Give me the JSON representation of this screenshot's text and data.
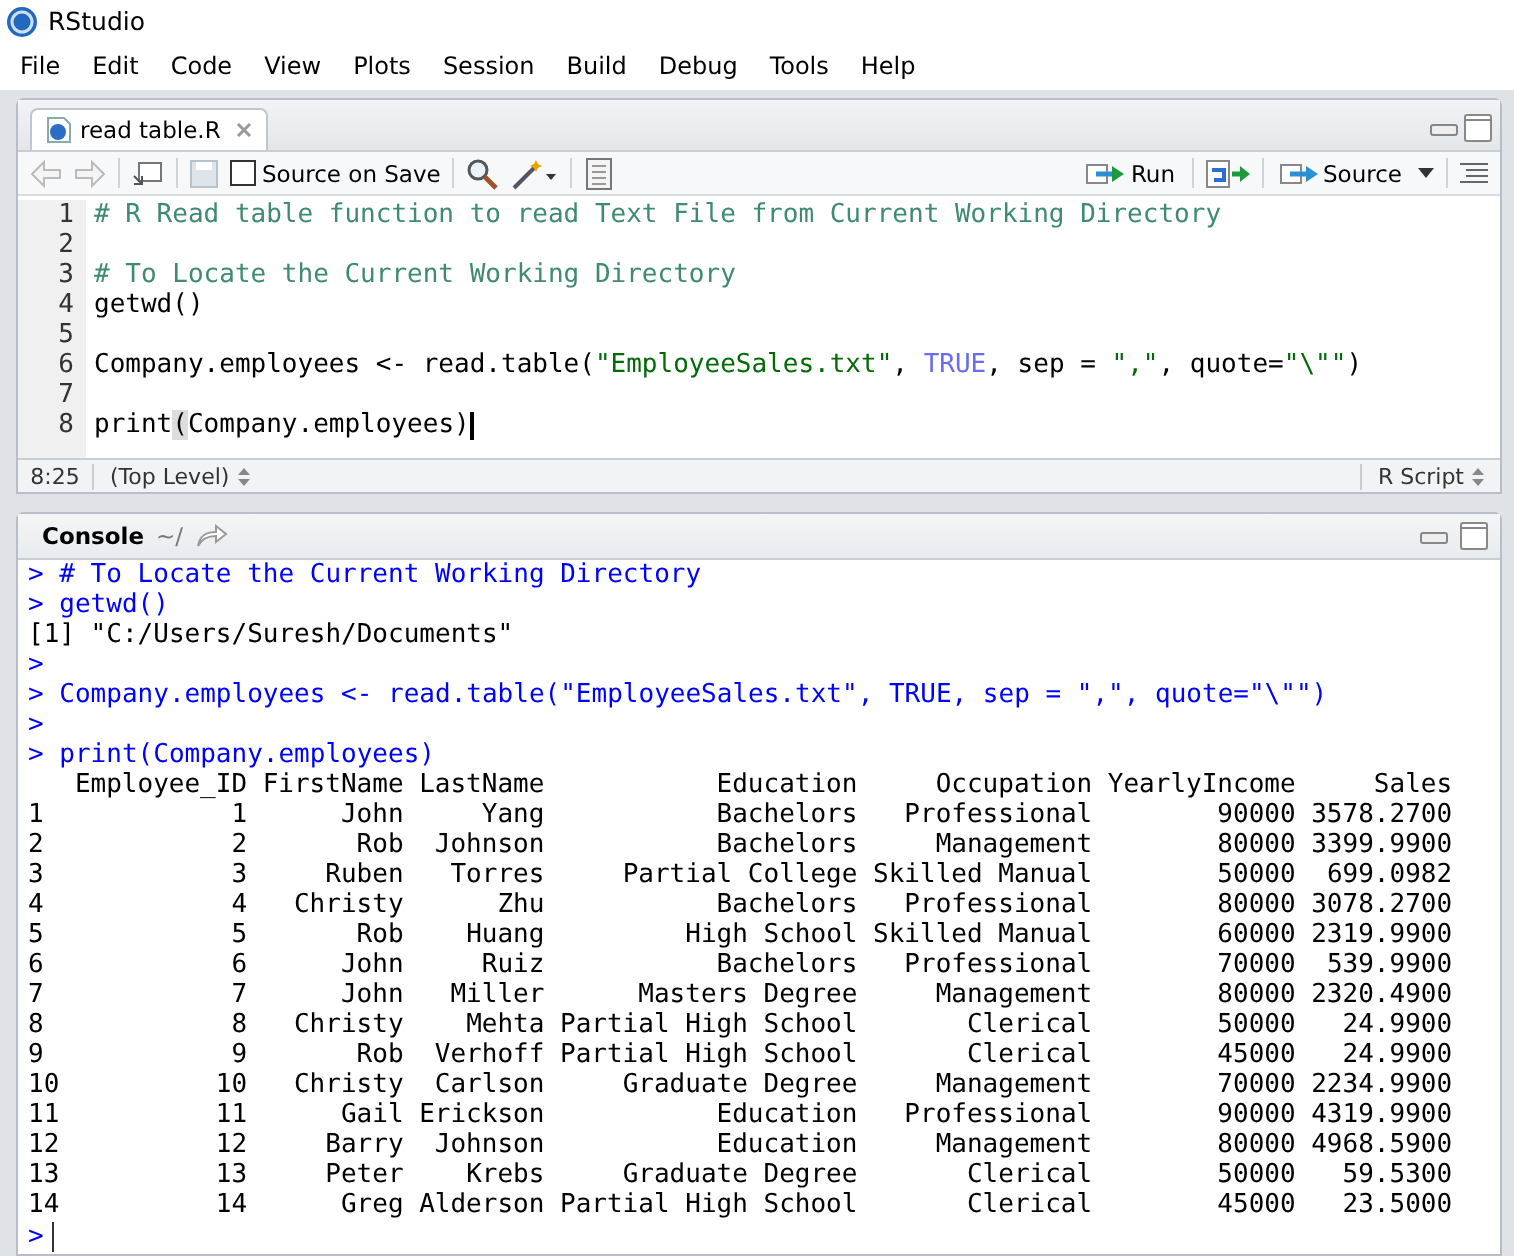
{
  "window": {
    "title": "RStudio"
  },
  "menu": [
    "File",
    "Edit",
    "Code",
    "View",
    "Plots",
    "Session",
    "Build",
    "Debug",
    "Tools",
    "Help"
  ],
  "editor": {
    "tab": {
      "label": "read table.R",
      "selected": true
    },
    "toolbar": {
      "source_on_save": {
        "label": "Source on Save",
        "checked": false
      },
      "run": "Run",
      "source": "Source"
    },
    "lines": [
      {
        "number": "1",
        "segments": [
          {
            "kind": "comment",
            "text": "# R Read table function to read Text File from Current Working Directory"
          }
        ]
      },
      {
        "number": "2"
      },
      {
        "number": "3",
        "segments": [
          {
            "kind": "comment",
            "text": "# To Locate the Current Working Directory"
          }
        ]
      },
      {
        "number": "4",
        "segments": [
          {
            "kind": "plain",
            "text": "getwd()"
          }
        ]
      },
      {
        "number": "5"
      },
      {
        "number": "6",
        "segments": [
          {
            "kind": "plain",
            "text": "Company.employees <- read.table("
          },
          {
            "kind": "string",
            "text": "\"EmployeeSales.txt\""
          },
          {
            "kind": "plain",
            "text": ", "
          },
          {
            "kind": "keyword",
            "text": "TRUE"
          },
          {
            "kind": "plain",
            "text": ", sep = "
          },
          {
            "kind": "string",
            "text": "\",\""
          },
          {
            "kind": "plain",
            "text": ", quote="
          },
          {
            "kind": "string",
            "text": "\"\\\"\""
          },
          {
            "kind": "plain",
            "text": ")"
          }
        ]
      },
      {
        "number": "7"
      },
      {
        "number": "8",
        "cursor": true,
        "segments": [
          {
            "kind": "plain",
            "text": "print"
          },
          {
            "kind": "match",
            "text": "("
          },
          {
            "kind": "plain",
            "text": "Company.employees)"
          }
        ]
      }
    ],
    "status": {
      "position": "8:25",
      "scope": "(Top Level)",
      "file_type": "R Script"
    }
  },
  "console": {
    "title": "Console",
    "path": "~/",
    "lines": [
      {
        "kind": "input",
        "text": "> # To Locate the Current Working Directory"
      },
      {
        "kind": "input",
        "text": "> getwd()"
      },
      {
        "kind": "output",
        "text": "[1] \"C:/Users/Suresh/Documents\""
      },
      {
        "kind": "input",
        "text": ">"
      },
      {
        "kind": "input",
        "text": "> Company.employees <- read.table(\"EmployeeSales.txt\", TRUE, sep = \",\", quote=\"\\\"\")"
      },
      {
        "kind": "input",
        "text": ">"
      },
      {
        "kind": "input",
        "text": "> print(Company.employees)"
      }
    ],
    "table": {
      "columns": [
        "",
        "Employee_ID",
        "FirstName",
        "LastName",
        "Education",
        "Occupation",
        "YearlyIncome",
        "Sales"
      ],
      "rows": [
        [
          "1",
          "1",
          "John",
          "Yang",
          "Bachelors",
          "Professional",
          "90000",
          "3578.2700"
        ],
        [
          "2",
          "2",
          "Rob",
          "Johnson",
          "Bachelors",
          "Management",
          "80000",
          "3399.9900"
        ],
        [
          "3",
          "3",
          "Ruben",
          "Torres",
          "Partial College",
          "Skilled Manual",
          "50000",
          "699.0982"
        ],
        [
          "4",
          "4",
          "Christy",
          "Zhu",
          "Bachelors",
          "Professional",
          "80000",
          "3078.2700"
        ],
        [
          "5",
          "5",
          "Rob",
          "Huang",
          "High School",
          "Skilled Manual",
          "60000",
          "2319.9900"
        ],
        [
          "6",
          "6",
          "John",
          "Ruiz",
          "Bachelors",
          "Professional",
          "70000",
          "539.9900"
        ],
        [
          "7",
          "7",
          "John",
          "Miller",
          "Masters Degree",
          "Management",
          "80000",
          "2320.4900"
        ],
        [
          "8",
          "8",
          "Christy",
          "Mehta",
          "Partial High School",
          "Clerical",
          "50000",
          "24.9900"
        ],
        [
          "9",
          "9",
          "Rob",
          "Verhoff",
          "Partial High School",
          "Clerical",
          "45000",
          "24.9900"
        ],
        [
          "10",
          "10",
          "Christy",
          "Carlson",
          "Graduate Degree",
          "Management",
          "70000",
          "2234.9900"
        ],
        [
          "11",
          "11",
          "Gail",
          "Erickson",
          "Education",
          "Professional",
          "90000",
          "4319.9900"
        ],
        [
          "12",
          "12",
          "Barry",
          "Johnson",
          "Education",
          "Management",
          "80000",
          "4968.5900"
        ],
        [
          "13",
          "13",
          "Peter",
          "Krebs",
          "Graduate Degree",
          "Clerical",
          "50000",
          "59.5300"
        ],
        [
          "14",
          "14",
          "Greg",
          "Alderson",
          "Partial High School",
          "Clerical",
          "45000",
          "23.5000"
        ]
      ]
    },
    "prompt": ">"
  }
}
